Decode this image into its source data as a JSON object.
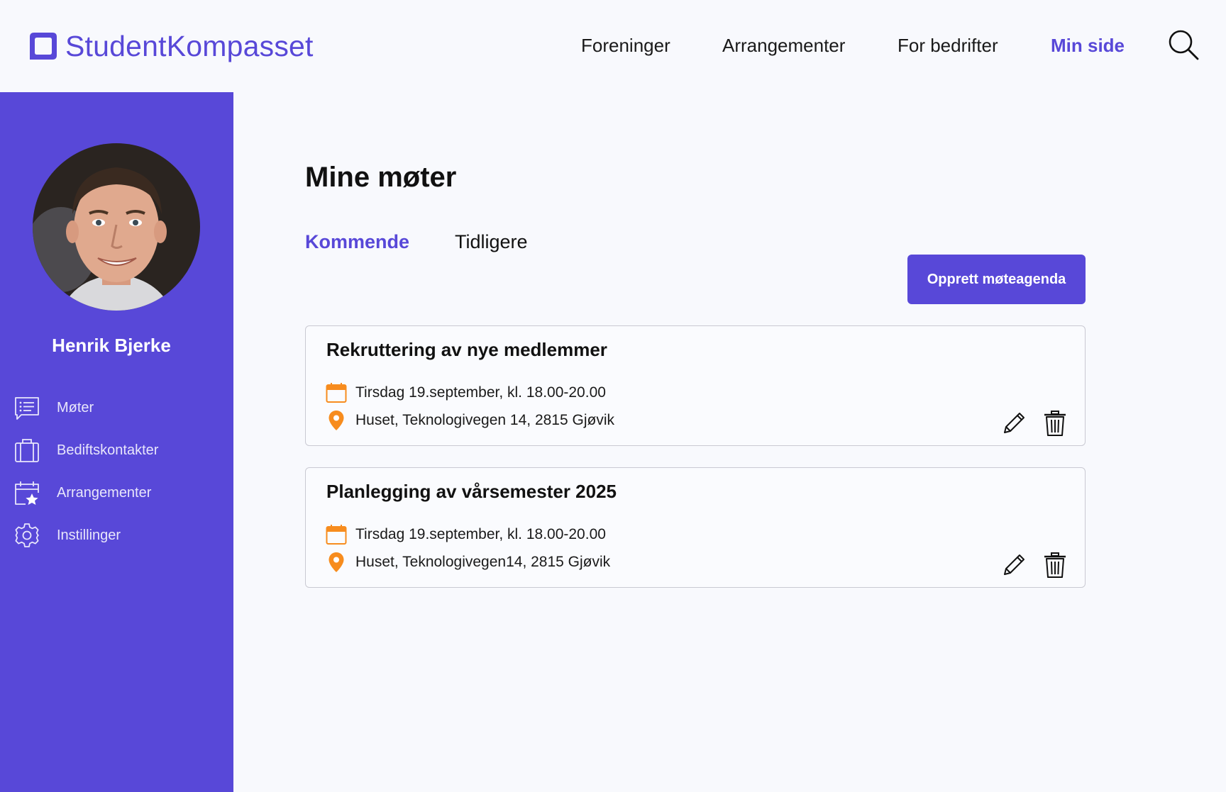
{
  "brand": {
    "name": "StudentKompasset",
    "color": "#5848d8",
    "logo_icon": "rounded-square-logo-icon"
  },
  "nav": {
    "items": [
      {
        "label": "Foreninger",
        "active": false
      },
      {
        "label": "Arrangementer",
        "active": false
      },
      {
        "label": "For bedrifter",
        "active": false
      },
      {
        "label": "Min side",
        "active": true
      }
    ],
    "search_icon": "search-icon"
  },
  "sidebar": {
    "user_name": "Henrik Bjerke",
    "avatar_icon": "user-avatar",
    "items": [
      {
        "label": "Møter",
        "icon": "agenda-list-icon"
      },
      {
        "label": "Bediftskontakter",
        "icon": "briefcase-icon"
      },
      {
        "label": "Arrangementer",
        "icon": "calendar-star-icon"
      },
      {
        "label": "Instillinger",
        "icon": "gear-icon"
      }
    ]
  },
  "main": {
    "title": "Mine møter",
    "tabs": [
      {
        "label": "Kommende",
        "active": true
      },
      {
        "label": "Tidligere",
        "active": false
      }
    ],
    "create_button": "Opprett møteagenda",
    "meetings": [
      {
        "title": "Rekruttering av nye medlemmer",
        "date": "Tirsdag 19.september, kl. 18.00-20.00",
        "location": "Huset, Teknologivegen 14, 2815 Gjøvik"
      },
      {
        "title": "Planlegging av vårsemester 2025",
        "date": "Tirsdag 19.september, kl. 18.00-20.00",
        "location": "Huset, Teknologivegen14, 2815 Gjøvik"
      }
    ],
    "accent_color": "#f78c1e"
  }
}
